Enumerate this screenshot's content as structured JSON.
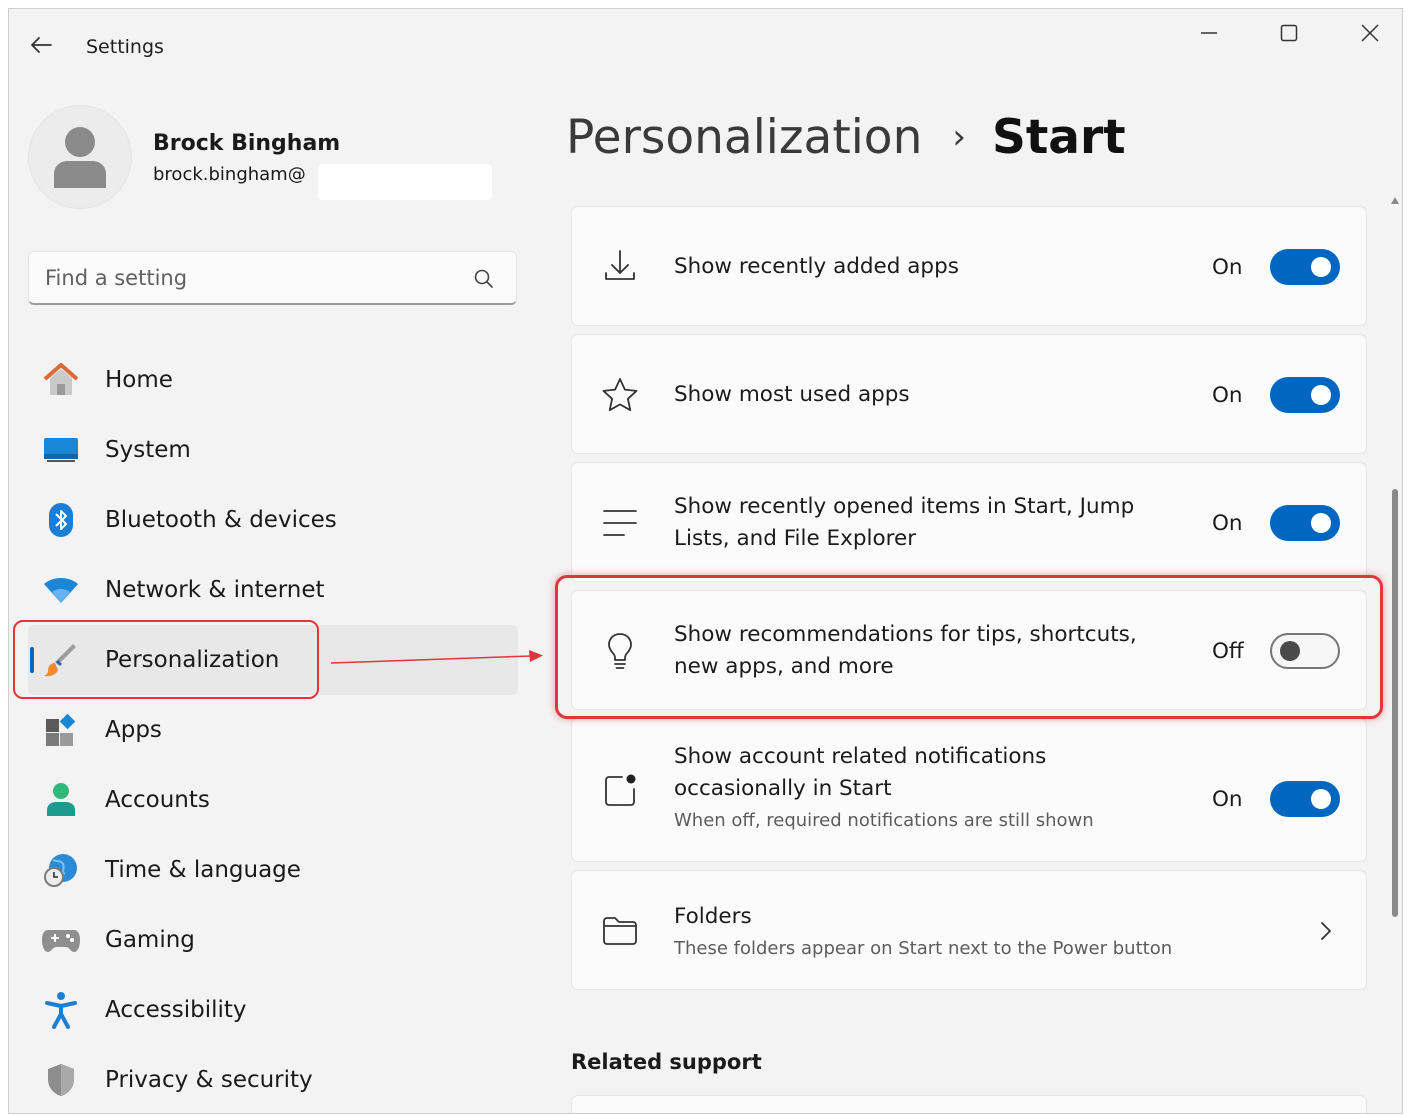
{
  "window": {
    "title": "Settings"
  },
  "profile": {
    "name": "Brock Bingham",
    "email": "brock.bingham@"
  },
  "search": {
    "placeholder": "Find a setting"
  },
  "nav": {
    "items": [
      {
        "label": "Home",
        "icon": "home-icon"
      },
      {
        "label": "System",
        "icon": "system-icon"
      },
      {
        "label": "Bluetooth & devices",
        "icon": "bluetooth-icon"
      },
      {
        "label": "Network & internet",
        "icon": "wifi-icon"
      },
      {
        "label": "Personalization",
        "icon": "brush-icon",
        "active": true
      },
      {
        "label": "Apps",
        "icon": "apps-icon"
      },
      {
        "label": "Accounts",
        "icon": "accounts-icon"
      },
      {
        "label": "Time & language",
        "icon": "globe-clock-icon"
      },
      {
        "label": "Gaming",
        "icon": "gamepad-icon"
      },
      {
        "label": "Accessibility",
        "icon": "accessibility-icon"
      },
      {
        "label": "Privacy & security",
        "icon": "shield-icon"
      }
    ]
  },
  "breadcrumb": {
    "parent": "Personalization",
    "separator": "›",
    "current": "Start"
  },
  "settings": [
    {
      "title": "Show recently added apps",
      "state": "On",
      "icon": "download-icon"
    },
    {
      "title": "Show most used apps",
      "state": "On",
      "icon": "star-icon"
    },
    {
      "title": "Show recently opened items in Start, Jump",
      "title2": "Lists, and File Explorer",
      "state": "On",
      "icon": "list-icon"
    },
    {
      "title": "Show recommendations for tips, shortcuts,",
      "title2": "new apps, and more",
      "state": "Off",
      "icon": "lightbulb-icon"
    },
    {
      "title": "Show account related notifications",
      "title2": "occasionally in Start",
      "description": "When off, required notifications are still shown",
      "state": "On",
      "icon": "notification-icon"
    },
    {
      "title": "Folders",
      "description": "These folders appear on Start next to the Power button",
      "icon": "folder-icon"
    }
  ],
  "related_support": {
    "label": "Related support"
  },
  "colors": {
    "accent": "#0067c0",
    "highlight": "#e2353c",
    "background": "#f3f3f3",
    "card": "#fbfbfb"
  }
}
